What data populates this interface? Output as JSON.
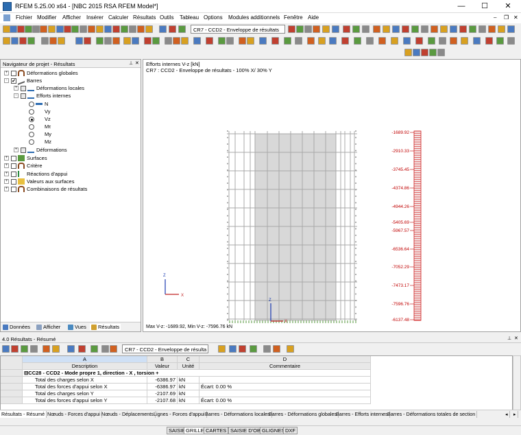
{
  "window": {
    "title": "RFEM 5.25.00 x64 - [NBC 2015 RSA RFEM Model*]",
    "min": "—",
    "max": "☐",
    "close": "✕"
  },
  "menu": [
    "Fichier",
    "Modifier",
    "Afficher",
    "Insérer",
    "Calculer",
    "Résultats",
    "Outils",
    "Tableau",
    "Options",
    "Modules additionnels",
    "Fenêtre",
    "Aide"
  ],
  "toolbar": {
    "combo": "CR7 - CCD2 - Enveloppe de résultats"
  },
  "navigator": {
    "title": "Navigateur de projet - Résultats",
    "items": [
      {
        "label": "Déformations globales",
        "exp": "+",
        "chk": ""
      },
      {
        "label": "Barres",
        "exp": "-",
        "chk": "✔"
      },
      {
        "label": "Déformations locales",
        "exp": "+",
        "chk": ""
      },
      {
        "label": "Efforts internes",
        "exp": "-",
        "chk": ""
      },
      {
        "label": "N"
      },
      {
        "label": "Vy"
      },
      {
        "label": "Vz"
      },
      {
        "label": "Mτ"
      },
      {
        "label": "My"
      },
      {
        "label": "Mz"
      },
      {
        "label": "Déformations",
        "exp": "+",
        "chk": ""
      },
      {
        "label": "Surfaces",
        "exp": "+",
        "chk": ""
      },
      {
        "label": "Critère",
        "exp": "+",
        "chk": ""
      },
      {
        "label": "Réactions d'appui",
        "exp": "+",
        "chk": ""
      },
      {
        "label": "Valeurs aux surfaces",
        "exp": "+",
        "chk": ""
      },
      {
        "label": "Combinaisons de résultats",
        "exp": "+",
        "chk": ""
      }
    ],
    "tabs": [
      "Données",
      "Afficher",
      "Vues",
      "Résultats"
    ]
  },
  "view": {
    "line1": "Efforts internes V-z [kN]",
    "line2": "CR7 : CCD2 - Enveloppe de résultats - 100% X/ 30% Y",
    "footer": "Max V-z: -1689.92, Min V-z: -7596.76 kN",
    "scale_labels": [
      "-1689.92",
      "-2910.33",
      "-3745.45",
      "-4374.86",
      "-4944.26",
      "-5405.69",
      "-5967.57",
      "-6536.64",
      "-7052.29",
      "-7473.17",
      "-7596.76",
      "-6137.48"
    ],
    "axis_z": "Z",
    "axis_x": "X"
  },
  "results": {
    "title": "4.0 Résultats - Résumé",
    "combo": "CR7 - CCD2 - Enveloppe de résulta",
    "col_letters": [
      "A",
      "B",
      "C",
      "D"
    ],
    "col_names": [
      "Description",
      "Valeur",
      "Unité",
      "Commentaire"
    ],
    "group": "CC28 - CCD2 - Mode propre 1, direction - X , torsion +",
    "rows": [
      {
        "desc": "Total des charges selon X",
        "val": "-6386.97",
        "unit": "kN",
        "comment": ""
      },
      {
        "desc": "Total des forces d'appui selon X",
        "val": "-6386.97",
        "unit": "kN",
        "comment": "Écart:  0.00 %"
      },
      {
        "desc": "Total des charges selon Y",
        "val": "-2107.69",
        "unit": "kN",
        "comment": ""
      },
      {
        "desc": "Total des forces d'appui selon Y",
        "val": "-2107.68",
        "unit": "kN",
        "comment": "Écart:  0.00 %"
      }
    ],
    "tabs": [
      "Résultats - Résumé",
      "Nœuds - Forces d'appui",
      "Nœuds - Déplacements",
      "Lignes - Forces d'appui",
      "Barres - Déformations locales",
      "Barres - Déformations globales",
      "Barres - Efforts internes",
      "Barres - Déformations totales de section"
    ]
  },
  "status": [
    "SAISIE",
    "GRILLE",
    "CARTES",
    "SAISIE D'OB.",
    "GLIGNES",
    "DXF"
  ]
}
